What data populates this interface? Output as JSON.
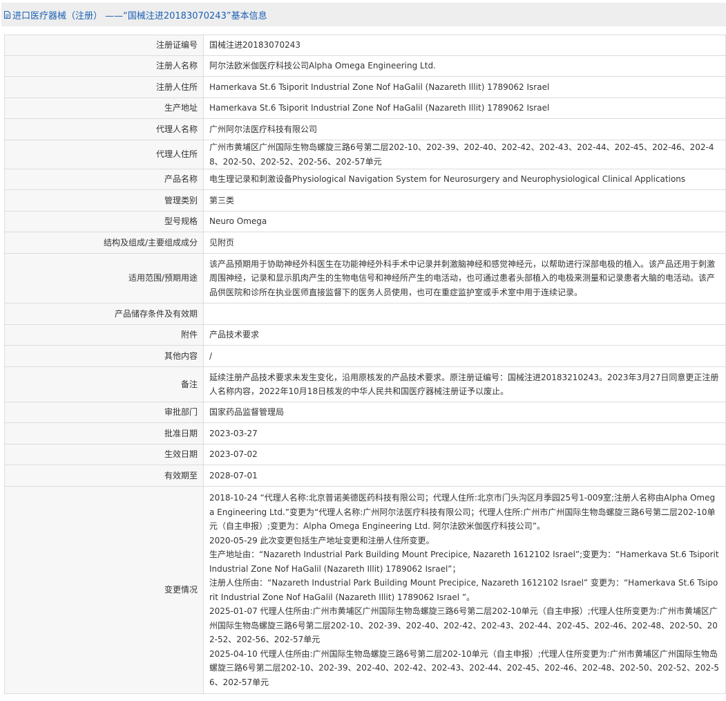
{
  "header": {
    "icon": "document-icon",
    "title": "进口医疗器械（注册） ——“国械注进20183070243”基本信息"
  },
  "rows": [
    {
      "label": "注册证编号",
      "value": "国械注进20183070243"
    },
    {
      "label": "注册人名称",
      "value": "阿尔法欧米伽医疗科技公司Alpha Omega Engineering Ltd."
    },
    {
      "label": "注册人住所",
      "value": "Hamerkava St.6 Tsiporit Industrial Zone Nof HaGalil (Nazareth Illit) 1789062 Israel"
    },
    {
      "label": "生产地址",
      "value": "Hamerkava St.6 Tsiporit Industrial Zone Nof HaGalil (Nazareth Illit) 1789062 Israel"
    },
    {
      "label": "代理人名称",
      "value": "广州阿尔法医疗科技有限公司"
    },
    {
      "label": "代理人住所",
      "value": "广州市黄埔区广州国际生物岛螺旋三路6号第二层202-10、202-39、202-40、202-42、202-43、202-44、202-45、202-46、202-48、202-50、202-52、202-56、202-57单元"
    },
    {
      "label": "产品名称",
      "value": "电生理记录和刺激设备Physiological Navigation System for Neurosurgery and Neurophysiological Clinical Applications"
    },
    {
      "label": "管理类别",
      "value": "第三类"
    },
    {
      "label": "型号规格",
      "value": "Neuro Omega"
    },
    {
      "label": "结构及组成/主要组成成分",
      "value": "见附页"
    },
    {
      "label": "适用范围/预期用途",
      "value": "该产品预期用于协助神经外科医生在功能神经外科手术中记录并刺激脑神经和感觉神经元，以帮助进行深部电极的植入。该产品还用于刺激周围神经，记录和显示肌肉产生的生物电信号和神经所产生的电活动，也可通过患者头部植入的电极来测量和记录患者大脑的电活动。该产品供医院和诊所在执业医师直接监督下的医务人员使用，也可在重症监护室或手术室中用于连续记录。"
    },
    {
      "label": "产品储存条件及有效期",
      "value": ""
    },
    {
      "label": "附件",
      "value": "产品技术要求"
    },
    {
      "label": "其他内容",
      "value": "/"
    },
    {
      "label": "备注",
      "value": "延续注册产品技术要求未发生变化，沿用原核发的产品技术要求。原注册证编号：国械注进20183210243。2023年3月27日同意更正注册人名称内容，2022年10月18日核发的中华人民共和国医疗器械注册证予以废止。"
    },
    {
      "label": "审批部门",
      "value": "国家药品监督管理局"
    },
    {
      "label": "批准日期",
      "value": "2023-03-27"
    },
    {
      "label": "生效日期",
      "value": "2023-07-02"
    },
    {
      "label": "有效期至",
      "value": "2028-07-01"
    },
    {
      "label": "变更情况",
      "paragraphs": [
        "2018-10-24 “代理人名称:北京普诺美德医药科技有限公司；代理人住所:北京市门头沟区月季园25号1-009室;注册人名称由Alpha Omega Engineering Ltd.”变更为“代理人名称:广州阿尔法医疗科技有限公司；代理人住所:广州市广州国际生物岛螺旋三路6号第二层202-10单元（自主申报）;变更为：Alpha Omega Engineering Ltd. 阿尔法欧米伽医疗科技公司”。",
        "2020-05-29 此次变更包括生产地址变更和注册人住所变更。",
        "生产地址由：“Nazareth Industrial Park Building Mount Precipice, Nazareth 1612102 Israel”;变更为：“Hamerkava St.6 Tsiporit Industrial Zone Nof HaGalil (Nazareth Illit) 1789062 Israel”；",
        "注册人住所由：“Nazareth Industrial Park Building Mount Precipice, Nazareth 1612102 Israel” 变更为：“Hamerkava St.6 Tsiporit Industrial Zone Nof HaGalil (Nazareth Illit) 1789062 Israel ”。",
        "2025-01-07 代理人住所由:广州市黄埔区广州国际生物岛螺旋三路6号第二层202-10单元（自主申报）;代理人住所变更为:广州市黄埔区广州国际生物岛螺旋三路6号第二层202-10、202-39、202-40、202-42、202-43、202-44、202-45、202-46、202-48、202-50、202-52、202-56、202-57单元",
        "2025-04-10 代理人住所由:广州国际生物岛螺旋三路6号第二层202-10单元（自主申报）;代理人住所变更为:广州市黄埔区广州国际生物岛螺旋三路6号第二层202-10、202-39、202-40、202-42、202-43、202-44、202-45、202-46、202-48、202-50、202-52、202-56、202-57单元"
      ]
    }
  ]
}
